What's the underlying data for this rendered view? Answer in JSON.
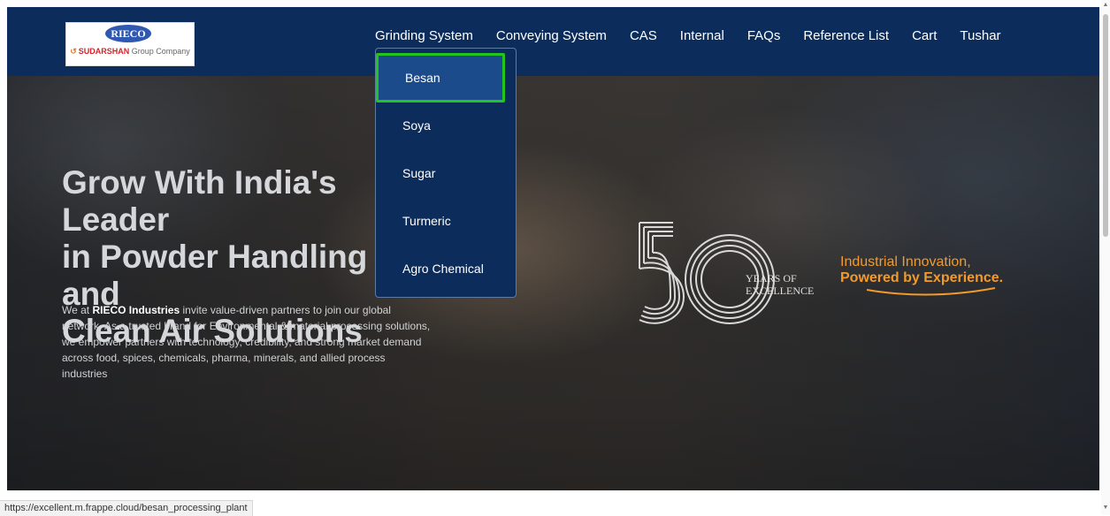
{
  "logo": {
    "brand": "RIECO",
    "company": "SUDARSHAN",
    "group": "Group Company"
  },
  "nav": {
    "items": [
      {
        "label": "Grinding System"
      },
      {
        "label": "Conveying System"
      },
      {
        "label": "CAS"
      },
      {
        "label": "Internal"
      },
      {
        "label": "FAQs"
      },
      {
        "label": "Reference List"
      },
      {
        "label": "Cart"
      },
      {
        "label": "Tushar"
      }
    ]
  },
  "dropdown": {
    "items": [
      {
        "label": "Besan"
      },
      {
        "label": "Soya"
      },
      {
        "label": "Sugar"
      },
      {
        "label": "Turmeric"
      },
      {
        "label": "Agro Chemical"
      }
    ]
  },
  "hero": {
    "heading": "Grow With India's Leader\nin Powder Handling and\nClean Air Solutions",
    "desc_lead": "We at ",
    "desc_brand": "RIECO Industries",
    "desc_rest": " invite value-driven partners to join our global network. As a trusted brand for Environmental & material processing solutions, we empower partners with technology, credibility, and strong market demand across food, spices, chemicals, pharma, minerals, and allied process industries",
    "years_text": "YEARS OF\nEXCELLENCE",
    "tagline_line1": "Industrial Innovation,",
    "tagline_line2": "Powered by Experience."
  },
  "status_bar": {
    "url": "https://excellent.m.frappe.cloud/besan_processing_plant"
  },
  "colors": {
    "navbar": "#0c2d5c",
    "highlight": "#22c41f",
    "accent": "#f39a2a"
  }
}
